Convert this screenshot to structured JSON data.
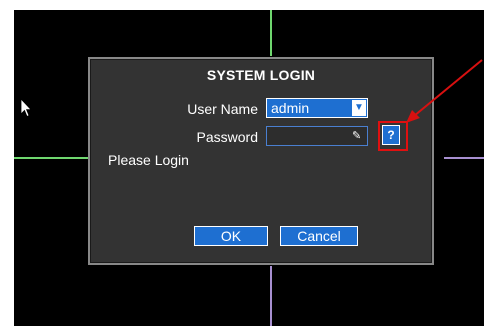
{
  "dialog": {
    "title": "SYSTEM LOGIN",
    "user_name_label": "User Name",
    "user_name_value": "admin",
    "password_label": "Password",
    "password_value": "",
    "help_label": "?",
    "status_text": "Please Login",
    "ok_label": "OK",
    "cancel_label": "Cancel"
  },
  "colors": {
    "dialog_bg": "#333333",
    "accent_blue": "#1e6fd1",
    "annotation_red": "#e01010",
    "grid_green": "#6fd76f",
    "grid_purple": "#a78fd0"
  },
  "icons": {
    "cursor": "mouse-pointer-icon",
    "dropdown": "chevron-down-icon",
    "edit": "pencil-icon",
    "help": "question-mark-icon",
    "annotation": "red-arrow-icon"
  }
}
